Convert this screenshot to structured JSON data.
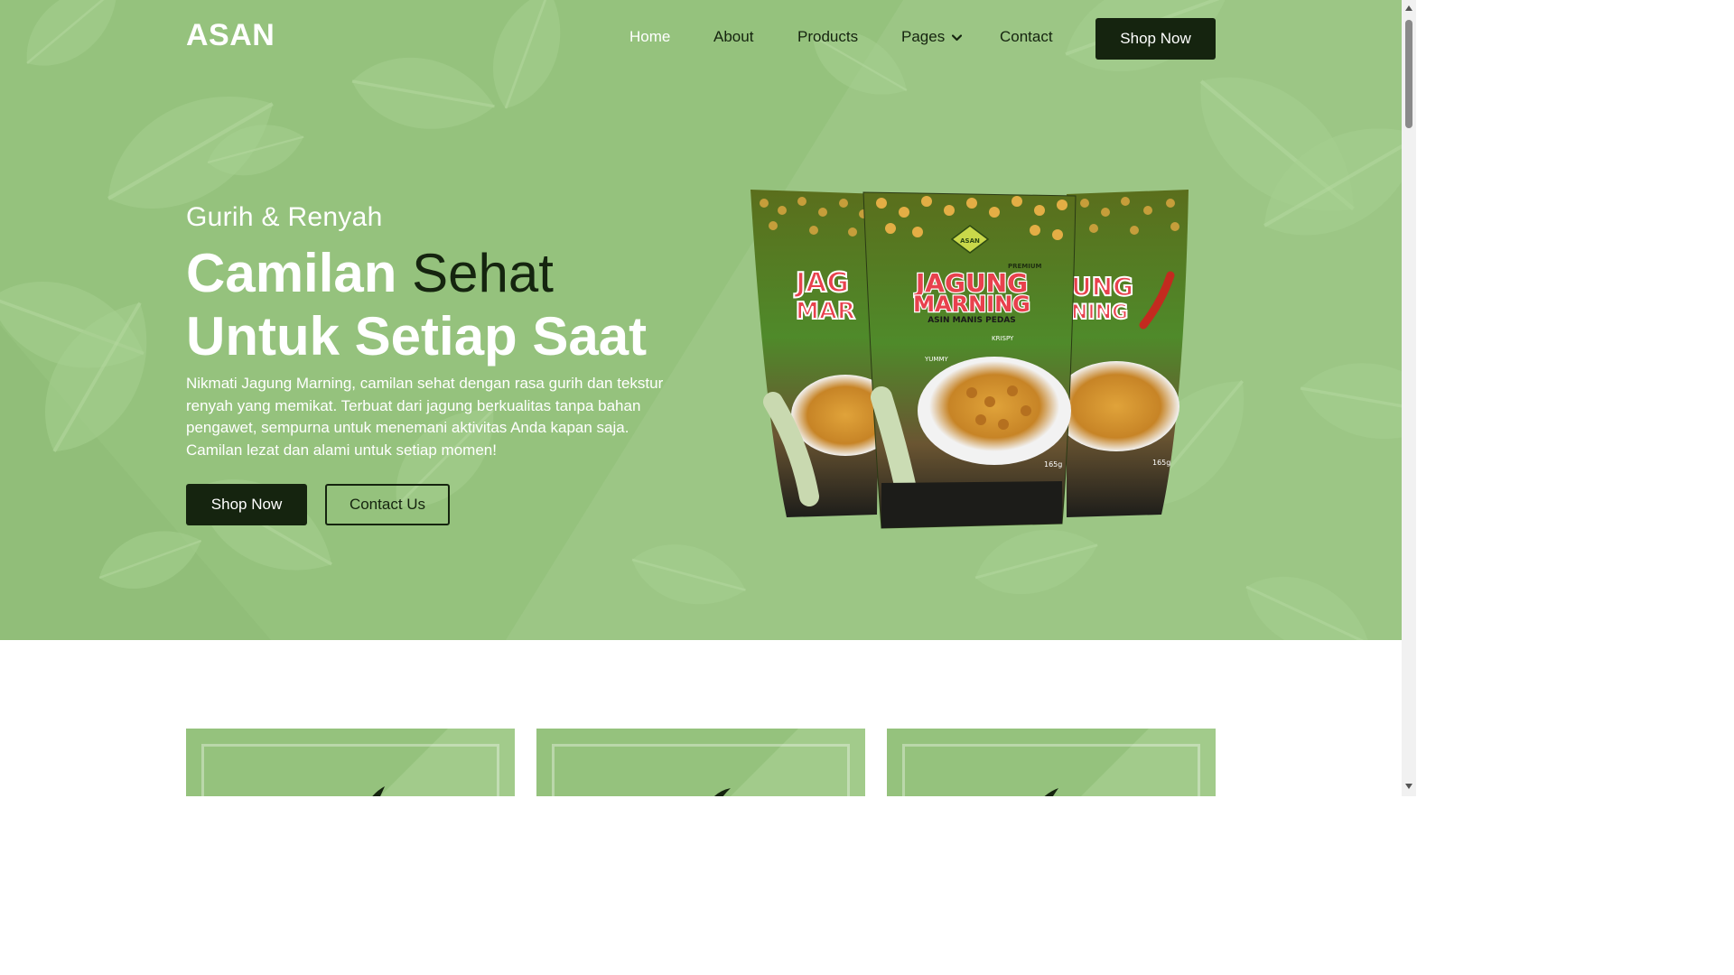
{
  "brand": "ASAN",
  "nav": {
    "home": "Home",
    "about": "About",
    "products": "Products",
    "pages": "Pages",
    "contact": "Contact",
    "shop_now": "Shop Now"
  },
  "hero": {
    "eyebrow": "Gurih & Renyah",
    "headline_bold_1": "Camilan",
    "headline_light": "Sehat",
    "headline_bold_2": "Untuk Setiap Saat",
    "description": "Nikmati Jagung Marning, camilan sehat dengan rasa gurih dan tekstur renyah yang memikat. Terbuat dari jagung berkualitas tanpa bahan pengawet, sempurna untuk menemani aktivitas Anda kapan saja. Camilan lezat dan alami untuk setiap momen!",
    "primary_button": "Shop Now",
    "secondary_button": "Contact Us"
  },
  "product_image": {
    "brand_mark": "ASAN",
    "tag": "PREMIUM",
    "name_line_1": "JAGUNG",
    "name_line_2": "MARNING",
    "flavor": "ASIN MANIS PEDAS",
    "label_1": "YUMMY",
    "label_2": "KRISPY",
    "weight": "165g"
  },
  "colors": {
    "hero_green": "#95c27d",
    "dark": "#15240f",
    "white": "#ffffff"
  }
}
